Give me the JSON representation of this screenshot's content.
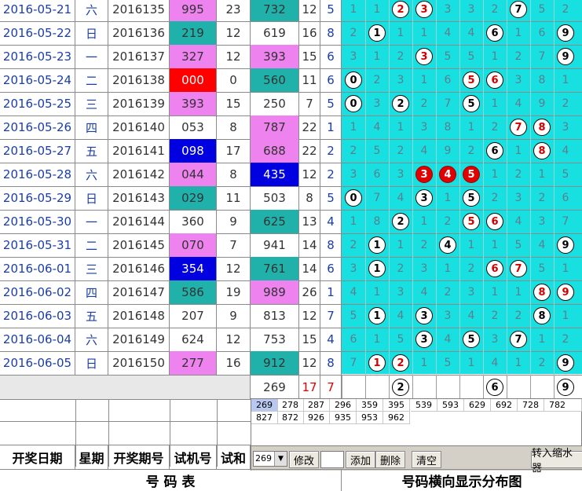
{
  "rows": [
    {
      "date": "2016-05-21",
      "weekday": "六",
      "period": "2016135",
      "trial": "995",
      "trial_sum": "23",
      "draw": "732",
      "draw_sum": "12",
      "span": "5",
      "grid": [
        "1",
        "1",
        "2",
        "3",
        "3",
        "3",
        "2",
        "7",
        "5",
        "2"
      ],
      "balls": [
        2,
        3,
        7
      ]
    },
    {
      "date": "2016-05-22",
      "weekday": "日",
      "period": "2016136",
      "trial": "219",
      "trial_sum": "12",
      "draw": "619",
      "draw_sum": "16",
      "span": "8",
      "grid": [
        "2",
        "1",
        "1",
        "1",
        "4",
        "4",
        "6",
        "1",
        "6",
        "9"
      ],
      "balls": [
        1,
        6,
        9
      ]
    },
    {
      "date": "2016-05-23",
      "weekday": "一",
      "period": "2016137",
      "trial": "327",
      "trial_sum": "12",
      "draw": "393",
      "draw_sum": "15",
      "span": "6",
      "grid": [
        "3",
        "1",
        "2",
        "3",
        "5",
        "5",
        "1",
        "2",
        "7",
        "9"
      ],
      "balls": [
        3,
        9
      ]
    },
    {
      "date": "2016-05-24",
      "weekday": "二",
      "period": "2016138",
      "trial": "000",
      "trial_sum": "0",
      "draw": "560",
      "draw_sum": "11",
      "span": "6",
      "grid": [
        "0",
        "2",
        "3",
        "1",
        "6",
        "5",
        "6",
        "3",
        "8",
        "1"
      ],
      "balls": [
        0,
        5,
        6
      ]
    },
    {
      "date": "2016-05-25",
      "weekday": "三",
      "period": "2016139",
      "trial": "393",
      "trial_sum": "15",
      "draw": "250",
      "draw_sum": "7",
      "span": "5",
      "grid": [
        "0",
        "3",
        "2",
        "2",
        "7",
        "5",
        "1",
        "4",
        "9",
        "2"
      ],
      "balls": [
        0,
        2,
        5
      ]
    },
    {
      "date": "2016-05-26",
      "weekday": "四",
      "period": "2016140",
      "trial": "053",
      "trial_sum": "8",
      "draw": "787",
      "draw_sum": "22",
      "span": "1",
      "grid": [
        "1",
        "4",
        "1",
        "3",
        "8",
        "1",
        "2",
        "7",
        "8",
        "3"
      ],
      "balls": [
        7,
        8
      ]
    },
    {
      "date": "2016-05-27",
      "weekday": "五",
      "period": "2016141",
      "trial": "098",
      "trial_sum": "17",
      "draw": "688",
      "draw_sum": "22",
      "span": "2",
      "grid": [
        "2",
        "5",
        "2",
        "4",
        "9",
        "2",
        "6",
        "1",
        "8",
        "4"
      ],
      "balls": [
        6,
        8
      ]
    },
    {
      "date": "2016-05-28",
      "weekday": "六",
      "period": "2016142",
      "trial": "044",
      "trial_sum": "8",
      "draw": "435",
      "draw_sum": "12",
      "span": "2",
      "grid": [
        "3",
        "6",
        "3",
        "3",
        "4",
        "5",
        "1",
        "2",
        "1",
        "5"
      ],
      "balls": [
        3,
        4,
        5
      ]
    },
    {
      "date": "2016-05-29",
      "weekday": "日",
      "period": "2016143",
      "trial": "029",
      "trial_sum": "11",
      "draw": "503",
      "draw_sum": "8",
      "span": "5",
      "grid": [
        "0",
        "7",
        "4",
        "3",
        "1",
        "5",
        "2",
        "3",
        "2",
        "6"
      ],
      "balls": [
        0,
        3,
        5
      ]
    },
    {
      "date": "2016-05-30",
      "weekday": "一",
      "period": "2016144",
      "trial": "360",
      "trial_sum": "9",
      "draw": "625",
      "draw_sum": "13",
      "span": "4",
      "grid": [
        "1",
        "8",
        "2",
        "1",
        "2",
        "5",
        "6",
        "4",
        "3",
        "7"
      ],
      "balls": [
        2,
        5,
        6
      ]
    },
    {
      "date": "2016-05-31",
      "weekday": "二",
      "period": "2016145",
      "trial": "070",
      "trial_sum": "7",
      "draw": "941",
      "draw_sum": "14",
      "span": "8",
      "grid": [
        "2",
        "1",
        "1",
        "2",
        "4",
        "1",
        "1",
        "5",
        "4",
        "9"
      ],
      "balls": [
        1,
        4,
        9
      ]
    },
    {
      "date": "2016-06-01",
      "weekday": "三",
      "period": "2016146",
      "trial": "354",
      "trial_sum": "12",
      "draw": "761",
      "draw_sum": "14",
      "span": "6",
      "grid": [
        "3",
        "1",
        "2",
        "3",
        "1",
        "2",
        "6",
        "7",
        "5",
        "1"
      ],
      "balls": [
        1,
        6,
        7
      ]
    },
    {
      "date": "2016-06-02",
      "weekday": "四",
      "period": "2016147",
      "trial": "586",
      "trial_sum": "19",
      "draw": "989",
      "draw_sum": "26",
      "span": "1",
      "grid": [
        "4",
        "1",
        "3",
        "4",
        "2",
        "3",
        "1",
        "1",
        "8",
        "9"
      ],
      "balls": [
        8,
        9
      ]
    },
    {
      "date": "2016-06-03",
      "weekday": "五",
      "period": "2016148",
      "trial": "207",
      "trial_sum": "9",
      "draw": "813",
      "draw_sum": "12",
      "span": "7",
      "grid": [
        "5",
        "1",
        "4",
        "3",
        "3",
        "4",
        "2",
        "2",
        "8",
        "1"
      ],
      "balls": [
        1,
        3,
        8
      ]
    },
    {
      "date": "2016-06-04",
      "weekday": "六",
      "period": "2016149",
      "trial": "624",
      "trial_sum": "12",
      "draw": "753",
      "draw_sum": "15",
      "span": "4",
      "grid": [
        "6",
        "1",
        "5",
        "3",
        "4",
        "5",
        "3",
        "7",
        "1",
        "2"
      ],
      "balls": [
        3,
        5,
        7
      ]
    },
    {
      "date": "2016-06-05",
      "weekday": "日",
      "period": "2016150",
      "trial": "277",
      "trial_sum": "16",
      "draw": "912",
      "draw_sum": "12",
      "span": "8",
      "grid": [
        "7",
        "1",
        "2",
        "1",
        "5",
        "1",
        "4",
        "1",
        "2",
        "9"
      ],
      "balls": [
        1,
        2,
        9
      ]
    }
  ],
  "pending": {
    "draw": "269",
    "draw_sum": "17",
    "span": "7",
    "balls": [
      2,
      6,
      9
    ]
  },
  "headers": {
    "date": "开奖日期",
    "weekday": "星期",
    "period": "开奖期号",
    "trial": "试机号",
    "trial_sum": "试和"
  },
  "footer": {
    "left": "号  码  表",
    "right": "号码横向显示分布图"
  },
  "numbers_panel": {
    "rows": [
      [
        "269",
        "278",
        "287",
        "296",
        "359",
        "395",
        "539",
        "593",
        "629",
        "692",
        "728",
        "782"
      ],
      [
        "827",
        "872",
        "926",
        "935",
        "953",
        "962"
      ]
    ]
  },
  "toolbar": {
    "select_value": "269",
    "modify": "修改",
    "add": "添加",
    "delete": "删除",
    "clear": "清空",
    "shrink": "转入缩水器"
  },
  "colors": {
    "cyan": "#19e0e0",
    "teal": "#20b2aa",
    "pink": "#ee82ee",
    "red": "#ff0000",
    "blue": "#0000e0",
    "ball_red": "#e00000",
    "grid_bg": "#19e0e0"
  },
  "trial_highlight": {
    "2016138": "red",
    "2016141": "blue",
    "2016146": "blue",
    "2016135": "pink",
    "2016139": "pink",
    "2016142": "pink",
    "2016145": "pink",
    "2016136": "teal",
    "2016137": "pink",
    "2016143": "teal",
    "2016147": "teal",
    "2016150": "pink"
  },
  "draw_highlight": {
    "2016135": "teal",
    "2016137": "pink",
    "2016138": "teal",
    "2016140": "pink",
    "2016141": "pink",
    "2016142": "blue",
    "2016144": "teal",
    "2016146": "teal",
    "2016147": "pink",
    "2016150": "teal"
  }
}
